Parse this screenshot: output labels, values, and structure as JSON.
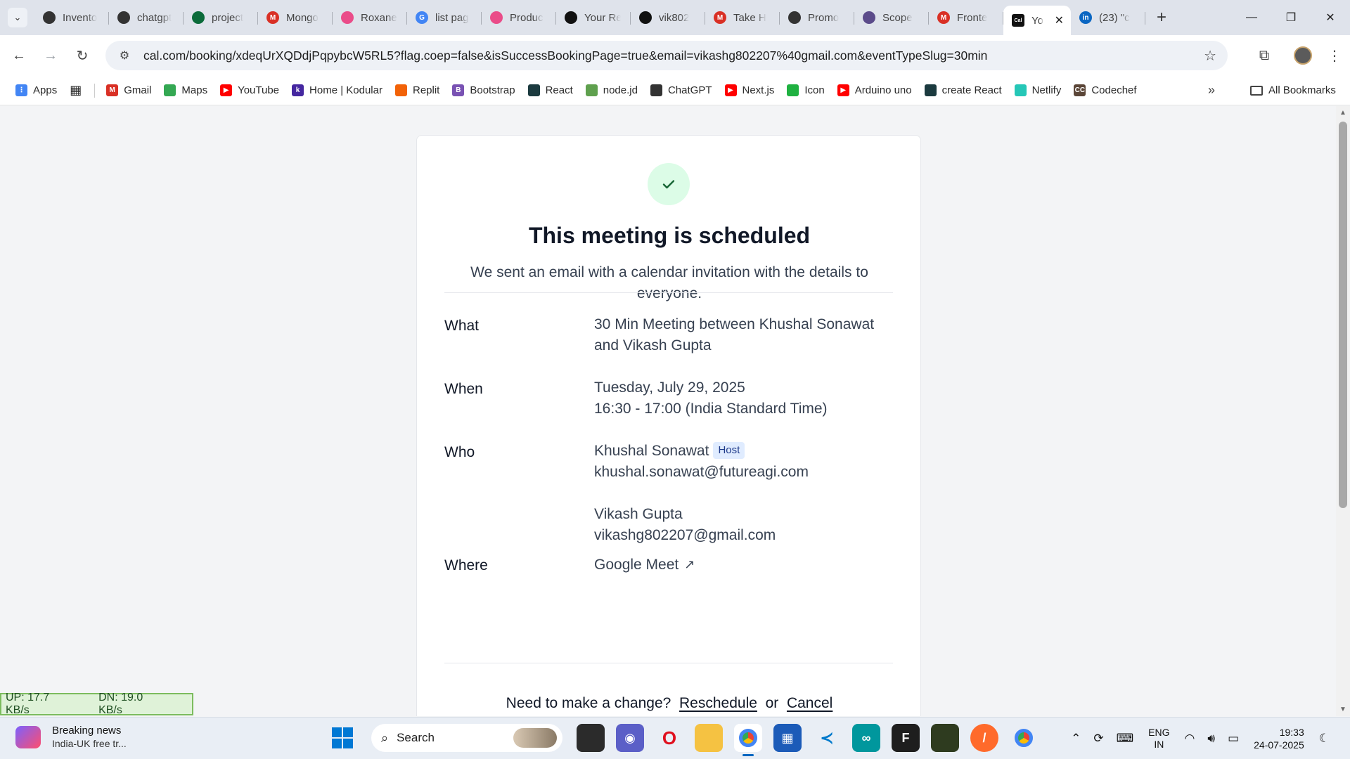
{
  "browser": {
    "tabs": [
      {
        "label": "Invento",
        "icon": "chatgpt-icon",
        "color": "#333333",
        "glyph": ""
      },
      {
        "label": "chatgpt",
        "icon": "chatgpt-icon",
        "color": "#333333",
        "glyph": ""
      },
      {
        "label": "project",
        "icon": "mongodb-icon",
        "color": "#0b6b3a",
        "glyph": ""
      },
      {
        "label": "Mongo",
        "icon": "gmail-icon",
        "color": "#d93025",
        "glyph": "M"
      },
      {
        "label": "Roxane",
        "icon": "dribbble-icon",
        "color": "#ea4c89",
        "glyph": ""
      },
      {
        "label": "list pag",
        "icon": "google-icon",
        "color": "#4285f4",
        "glyph": "G"
      },
      {
        "label": "Produc",
        "icon": "dribbble-icon",
        "color": "#ea4c89",
        "glyph": ""
      },
      {
        "label": "Your Re",
        "icon": "github-icon",
        "color": "#111111",
        "glyph": ""
      },
      {
        "label": "vik802",
        "icon": "github-icon",
        "color": "#111111",
        "glyph": ""
      },
      {
        "label": "Take H",
        "icon": "gmail-icon",
        "color": "#d93025",
        "glyph": "M"
      },
      {
        "label": "Promo",
        "icon": "chatgpt-icon",
        "color": "#333333",
        "glyph": ""
      },
      {
        "label": "Scope",
        "icon": "scope-icon",
        "color": "#5b4b8a",
        "glyph": ""
      },
      {
        "label": "Fronte",
        "icon": "gmail-icon",
        "color": "#d93025",
        "glyph": "M"
      },
      {
        "label": "Yo",
        "icon": "cal-icon",
        "color": "#111111",
        "glyph": "Cal",
        "active": true
      },
      {
        "label": "(23) \"c",
        "icon": "linkedin-icon",
        "color": "#0a66c2",
        "glyph": "in"
      }
    ],
    "url": "cal.com/booking/xdeqUrXQDdjPqpybcW5RL5?flag.coep=false&isSuccessBookingPage=true&email=vikashg802207%40gmail.com&eventTypeSlug=30min",
    "bookmarks": [
      {
        "label": "Apps",
        "icon": "apps-grid-icon",
        "color": "#4285f4",
        "glyph": "⋮"
      },
      {
        "label": "Gmail",
        "icon": "gmail-icon",
        "color": "#d93025",
        "glyph": "M"
      },
      {
        "label": "Maps",
        "icon": "maps-pin-icon",
        "color": "#34a853",
        "glyph": ""
      },
      {
        "label": "YouTube",
        "icon": "youtube-icon",
        "color": "#ff0000",
        "glyph": "▶"
      },
      {
        "label": "Home | Kodular",
        "icon": "kodular-icon",
        "color": "#4527a0",
        "glyph": "k"
      },
      {
        "label": "Replit",
        "icon": "replit-icon",
        "color": "#f26207",
        "glyph": ""
      },
      {
        "label": "Bootstrap",
        "icon": "bootstrap-icon",
        "color": "#7952b3",
        "glyph": "B"
      },
      {
        "label": "React",
        "icon": "react-icon",
        "color": "#1b3a3f",
        "glyph": ""
      },
      {
        "label": "node.jd",
        "icon": "nodejs-icon",
        "color": "#5fa04e",
        "glyph": ""
      },
      {
        "label": "ChatGPT",
        "icon": "chatgpt-icon",
        "color": "#333333",
        "glyph": ""
      },
      {
        "label": "Next.js",
        "icon": "youtube-icon",
        "color": "#ff0000",
        "glyph": "▶"
      },
      {
        "label": "Icon",
        "icon": "icon-site-icon",
        "color": "#1fb141",
        "glyph": ""
      },
      {
        "label": "Arduino uno",
        "icon": "youtube-icon",
        "color": "#ff0000",
        "glyph": "▶"
      },
      {
        "label": "create React",
        "icon": "react-icon",
        "color": "#1b3a3f",
        "glyph": ""
      },
      {
        "label": "Netlify",
        "icon": "netlify-icon",
        "color": "#25c7b7",
        "glyph": ""
      },
      {
        "label": "Codechef",
        "icon": "codechef-icon",
        "color": "#5b4638",
        "glyph": "CC"
      }
    ],
    "all_bookmarks": "All Bookmarks"
  },
  "booking": {
    "title": "This meeting is scheduled",
    "subtitle": "We sent an email with a calendar invitation with the details to everyone.",
    "what_label": "What",
    "what_value": "30 Min Meeting between Khushal Sonawat and Vikash Gupta",
    "when_label": "When",
    "when_date": "Tuesday, July 29, 2025",
    "when_time": "16:30 - 17:00 (India Standard Time)",
    "who_label": "Who",
    "host_name": "Khushal Sonawat",
    "host_badge": "Host",
    "host_email": "khushal.sonawat@futureagi.com",
    "guest_name": "Vikash Gupta",
    "guest_email": "vikashg802207@gmail.com",
    "where_label": "Where",
    "where_value": "Google Meet",
    "change_prompt": "Need to make a change?",
    "reschedule": "Reschedule",
    "or": "or",
    "cancel": "Cancel",
    "accent": "#dcfce7"
  },
  "netspeed": {
    "up": "UP: 17.7 KB/s",
    "down": "DN: 19.0 KB/s"
  },
  "taskbar": {
    "news_title": "Breaking news",
    "news_sub": "India-UK free tr...",
    "search": "Search",
    "lang_top": "ENG",
    "lang_bottom": "IN",
    "time": "19:33",
    "date": "24-07-2025"
  }
}
